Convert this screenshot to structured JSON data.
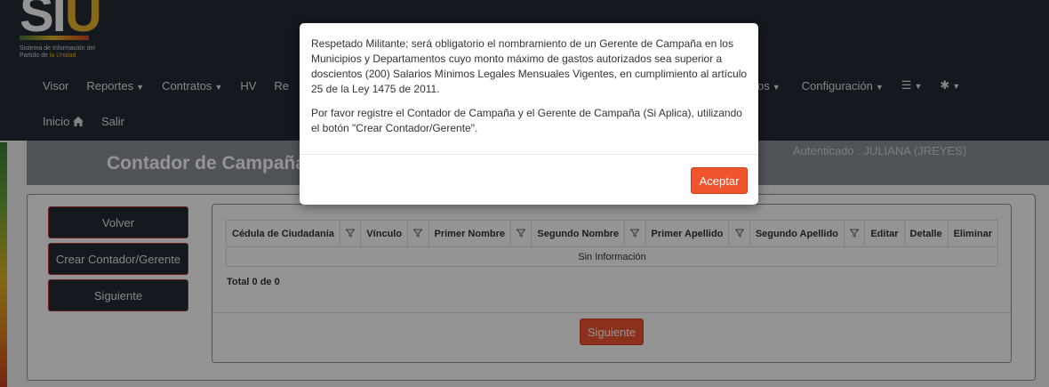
{
  "navbar": {
    "logo": {
      "text_si": "SI",
      "text_u": "U",
      "subtitle_line1": "Sistema de Información del",
      "subtitle_line2_prefix": "Partido de",
      "subtitle_line2_highlight": "la Unidad"
    },
    "row1": [
      {
        "label": "Visor",
        "caret": false
      },
      {
        "label": "Reportes",
        "caret": true
      },
      {
        "label": "Contratos",
        "caret": true
      },
      {
        "label": "HV",
        "caret": false
      },
      {
        "label": "Re",
        "caret": false
      }
    ],
    "row1_right": [
      {
        "label": "os",
        "caret": true
      },
      {
        "label": "Configuración",
        "caret": true
      },
      {
        "label": "☰",
        "caret": true,
        "icon": "menu-icon"
      },
      {
        "label": "✱",
        "caret": true,
        "icon": "gear-icon"
      }
    ],
    "row2": [
      {
        "label": "Inicio",
        "icon": "home-icon"
      },
      {
        "label": "Salir"
      }
    ]
  },
  "header": {
    "title": "Contador de Campaña",
    "authenticated": "Autenticado : JULIANA (JREYES)"
  },
  "side_buttons": {
    "back": "Volver",
    "create": "Crear Contador/Gerente",
    "next": "Siguiente"
  },
  "table": {
    "columns": [
      "Cédula de Ciudadanía",
      "Vínculo",
      "Primer Nombre",
      "Segundo Nombre",
      "Primer Apellido",
      "Segundo Apellido"
    ],
    "action_columns": [
      "Editar",
      "Detalle",
      "Eliminar"
    ],
    "filter_icon": "filter-icon",
    "empty_text": "Sin Información",
    "total": "Total 0 de 0"
  },
  "bottom_button": "Siguiente",
  "modal": {
    "paragraph1": "Respetado Militante; será obligatorio el nombramiento de un Gerente de Campaña en los Municipios y Departamentos cuyo monto máximo de gastos autorizados sea superior a doscientos (200) Salarios Mínimos Legales Mensuales Vigentes, en cumplimiento al artículo 25 de la Ley 1475 de 2011.",
    "paragraph2": "Por favor registre el Contador de Campaña y el Gerente de Campaña (Si Aplica), utilizando el botón \"Crear Contador/Gerente\".",
    "accept": "Aceptar"
  },
  "colors": {
    "navbar": "#232a36",
    "accent_orange": "#f0542d",
    "header_band": "#8a9299",
    "logo_yellow": "#e9b52a"
  }
}
